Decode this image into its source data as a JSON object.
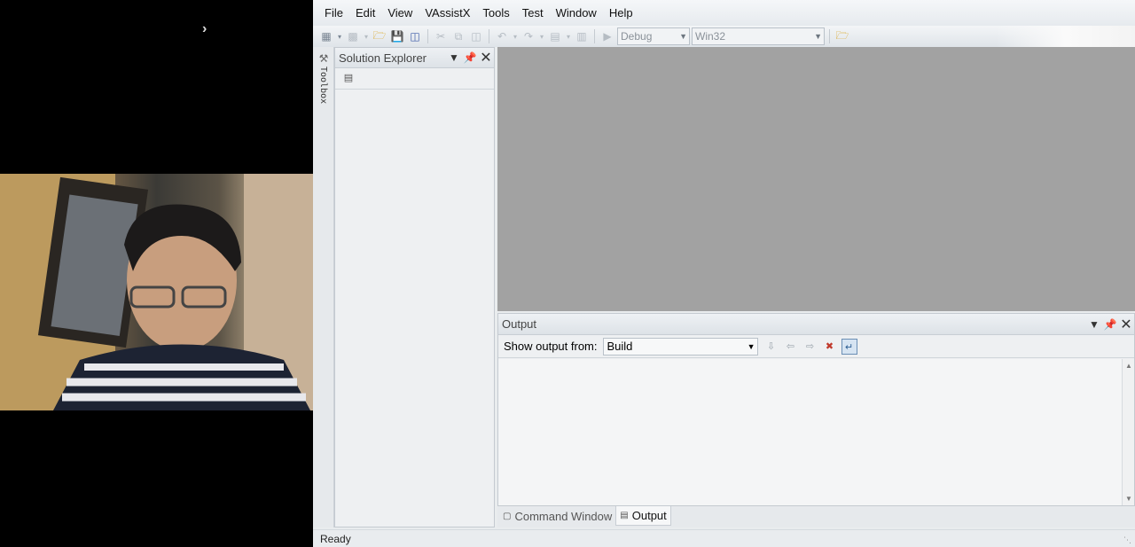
{
  "menubar": {
    "items": [
      "File",
      "Edit",
      "View",
      "VAssistX",
      "Tools",
      "Test",
      "Window",
      "Help"
    ]
  },
  "toolbar": {
    "config_combo": "Debug",
    "platform_combo": "Win32"
  },
  "toolbox": {
    "label": "Toolbox"
  },
  "solution_explorer": {
    "title": "Solution Explorer"
  },
  "output": {
    "title": "Output",
    "show_from_label": "Show output from:",
    "show_from_value": "Build"
  },
  "bottom_tabs": [
    "Command Window",
    "Output"
  ],
  "status": {
    "text": "Ready"
  },
  "icons": {
    "chevron": "chevron-right-icon",
    "close": "close-icon",
    "pin": "pin-icon",
    "dropdown": "chevron-down-icon"
  }
}
